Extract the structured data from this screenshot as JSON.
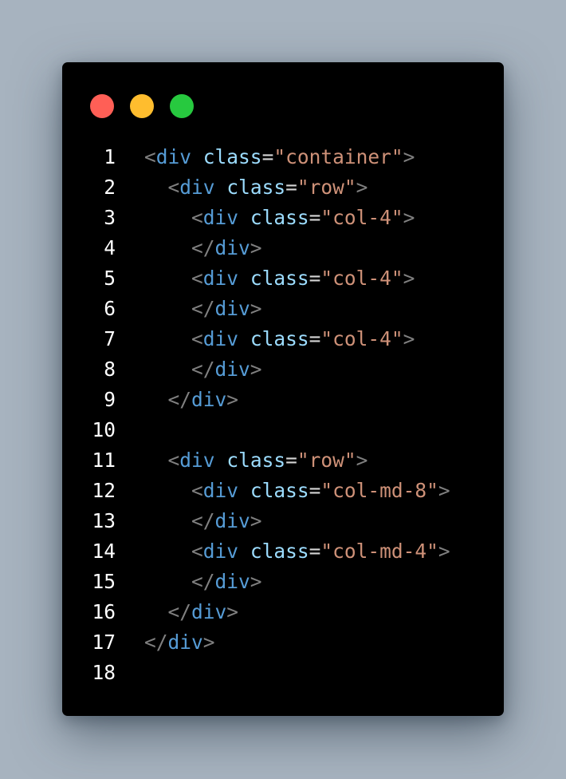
{
  "window": {
    "traffic_lights": [
      {
        "name": "close",
        "color": "#ff5f56"
      },
      {
        "name": "minimize",
        "color": "#ffbd2e"
      },
      {
        "name": "zoom",
        "color": "#27c93f"
      }
    ]
  },
  "theme": {
    "background": "#000000",
    "line_number_color": "#ffffff",
    "bracket_color": "#808080",
    "tag_color": "#569cd6",
    "attribute_color": "#9cdcfe",
    "string_color": "#ce9178"
  },
  "code": {
    "lines": [
      {
        "num": "1",
        "indent": "",
        "type": "open",
        "tag": "div",
        "attr": "class",
        "value": "\"container\""
      },
      {
        "num": "2",
        "indent": "  ",
        "type": "open",
        "tag": "div",
        "attr": "class",
        "value": "\"row\""
      },
      {
        "num": "3",
        "indent": "    ",
        "type": "open",
        "tag": "div",
        "attr": "class",
        "value": "\"col-4\""
      },
      {
        "num": "4",
        "indent": "    ",
        "type": "close",
        "tag": "div"
      },
      {
        "num": "5",
        "indent": "    ",
        "type": "open",
        "tag": "div",
        "attr": "class",
        "value": "\"col-4\""
      },
      {
        "num": "6",
        "indent": "    ",
        "type": "close",
        "tag": "div"
      },
      {
        "num": "7",
        "indent": "    ",
        "type": "open",
        "tag": "div",
        "attr": "class",
        "value": "\"col-4\""
      },
      {
        "num": "8",
        "indent": "    ",
        "type": "close",
        "tag": "div"
      },
      {
        "num": "9",
        "indent": "  ",
        "type": "close",
        "tag": "div"
      },
      {
        "num": "10",
        "indent": "",
        "type": "empty"
      },
      {
        "num": "11",
        "indent": "  ",
        "type": "open",
        "tag": "div",
        "attr": "class",
        "value": "\"row\""
      },
      {
        "num": "12",
        "indent": "    ",
        "type": "open",
        "tag": "div",
        "attr": "class",
        "value": "\"col-md-8\""
      },
      {
        "num": "13",
        "indent": "    ",
        "type": "close",
        "tag": "div"
      },
      {
        "num": "14",
        "indent": "    ",
        "type": "open",
        "tag": "div",
        "attr": "class",
        "value": "\"col-md-4\""
      },
      {
        "num": "15",
        "indent": "    ",
        "type": "close",
        "tag": "div"
      },
      {
        "num": "16",
        "indent": "  ",
        "type": "close",
        "tag": "div"
      },
      {
        "num": "17",
        "indent": "",
        "type": "close",
        "tag": "div"
      },
      {
        "num": "18",
        "indent": "",
        "type": "empty"
      }
    ]
  }
}
